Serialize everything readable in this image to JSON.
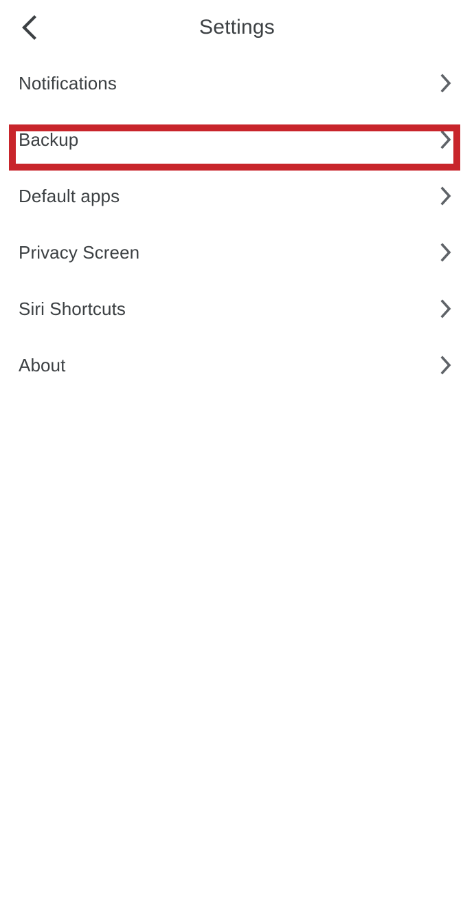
{
  "header": {
    "title": "Settings",
    "back_icon": "chevron-left-icon"
  },
  "list": {
    "chevron_icon": "chevron-right-icon",
    "items": [
      {
        "label": "Notifications"
      },
      {
        "label": "Backup"
      },
      {
        "label": "Default apps"
      },
      {
        "label": "Privacy Screen"
      },
      {
        "label": "Siri Shortcuts"
      },
      {
        "label": "About"
      }
    ]
  },
  "annotation": {
    "target_label": "Backup",
    "color": "#c8252b",
    "border_width_px": 10
  },
  "colors": {
    "background": "#ffffff",
    "text": "#3c4043",
    "chevron": "#5f6368",
    "highlight": "#c8252b"
  }
}
